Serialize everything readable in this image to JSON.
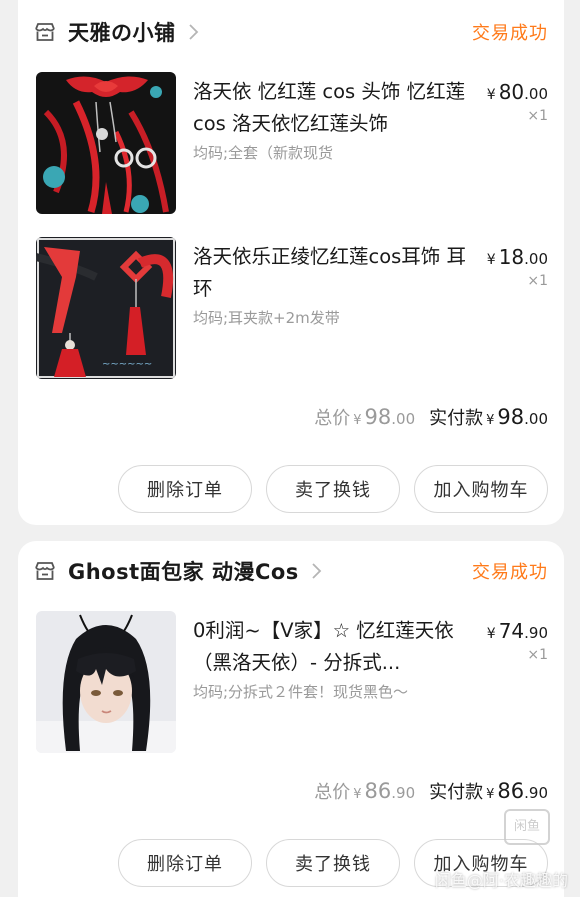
{
  "orders": [
    {
      "shop_name": "天雅の小铺",
      "status": "交易成功",
      "items": [
        {
          "title": "洛天依 忆红莲 cos 头饰 忆红莲cos  洛天依忆红莲头饰",
          "spec": "均码;全套（新款现货",
          "price_currency": "¥",
          "price_int": "80",
          "price_cents": ".00",
          "qty": "×1",
          "image": "red-hair-ornament-photo"
        },
        {
          "title": "洛天依乐正绫忆红莲cos耳饰 耳环",
          "spec": "均码;耳夹款+2m发带",
          "price_currency": "¥",
          "price_int": "18",
          "price_cents": ".00",
          "qty": "×1",
          "image": "red-earrings-photo"
        }
      ],
      "total_label": "总价",
      "total_int": "98",
      "total_cents": ".00",
      "paid_label": "实付款",
      "paid_int": "98",
      "paid_cents": ".00",
      "buttons": [
        "删除订单",
        "卖了换钱",
        "加入购物车"
      ]
    },
    {
      "shop_name": "Ghost面包家 动漫Cos",
      "status": "交易成功",
      "items": [
        {
          "title": "0利润~【V家】☆ 忆红莲天依（黑洛天依）- 分拆式...",
          "spec": "均码;分拆式２件套！现货黑色～",
          "price_currency": "¥",
          "price_int": "74",
          "price_cents": ".90",
          "qty": "×1",
          "image": "black-wig-photo"
        }
      ],
      "total_label": "总价",
      "total_int": "86",
      "total_cents": ".90",
      "paid_label": "实付款",
      "paid_int": "86",
      "paid_cents": ".90",
      "buttons": [
        "删除订单",
        "卖了换钱",
        "加入购物车"
      ]
    }
  ],
  "currency": "¥",
  "watermark": "闲鱼@阿·农趣趣的",
  "watermark_logo": "闲鱼",
  "colors": {
    "status": "#ff7a1a",
    "background": "#f0f0f0",
    "card": "#ffffff"
  }
}
